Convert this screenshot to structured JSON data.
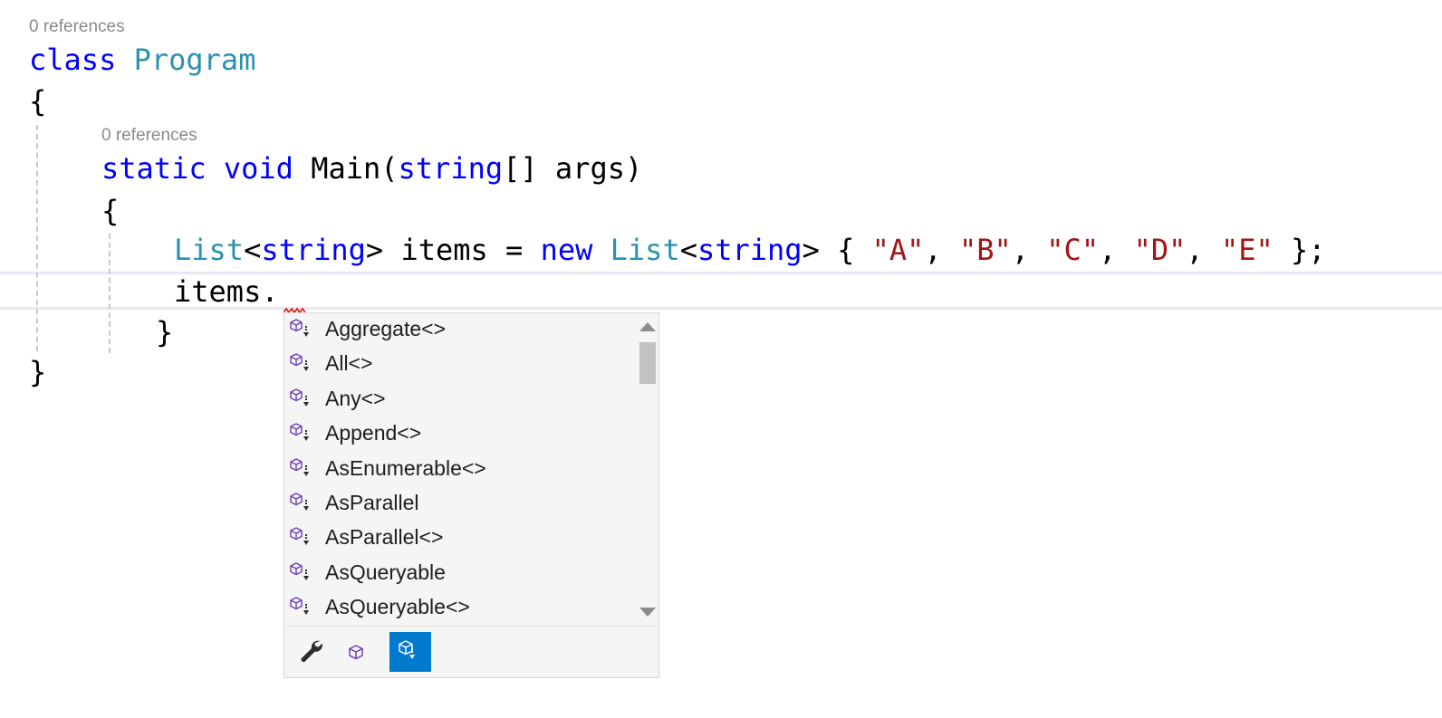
{
  "codelens": {
    "class_refs": "0 references",
    "method_refs": "0 references"
  },
  "code": {
    "line1": {
      "kw": "class",
      "type": "Program"
    },
    "line2": {
      "text": "{"
    },
    "line3": {
      "kw1": "static",
      "kw2": "void",
      "name": "Main(",
      "kw3": "string",
      "rest": "[] args)"
    },
    "line4": {
      "text": "{"
    },
    "line5": {
      "type1": "List",
      "lt1": "<",
      "kw1": "string",
      "mid1": "> items = ",
      "kw_new": "new",
      "type2": "List",
      "lt2": "<",
      "kw2": "string",
      "mid2": "> { ",
      "s1": "\"A\"",
      "c1": ", ",
      "s2": "\"B\"",
      "c2": ", ",
      "s3": "\"C\"",
      "c3": ", ",
      "s4": "\"D\"",
      "c4": ", ",
      "s5": "\"E\"",
      "end": " };"
    },
    "line6": {
      "text": "items."
    },
    "line7": {
      "text": "}"
    },
    "line8": {
      "text": "}"
    }
  },
  "completion": {
    "items": [
      {
        "label": "Aggregate<>",
        "icon": "extension-method-icon"
      },
      {
        "label": "All<>",
        "icon": "extension-method-icon"
      },
      {
        "label": "Any<>",
        "icon": "extension-method-icon"
      },
      {
        "label": "Append<>",
        "icon": "extension-method-icon"
      },
      {
        "label": "AsEnumerable<>",
        "icon": "extension-method-icon"
      },
      {
        "label": "AsParallel",
        "icon": "extension-method-icon"
      },
      {
        "label": "AsParallel<>",
        "icon": "extension-method-icon"
      },
      {
        "label": "AsQueryable",
        "icon": "extension-method-icon"
      },
      {
        "label": "AsQueryable<>",
        "icon": "extension-method-icon"
      }
    ],
    "filters": [
      {
        "icon": "wrench-icon",
        "active": false
      },
      {
        "icon": "method-icon",
        "active": false
      },
      {
        "icon": "extension-method-filter-icon",
        "active": true
      }
    ]
  },
  "colors": {
    "keyword": "#0000ff",
    "type": "#2b91af",
    "string": "#a31515",
    "codelens": "#8a8a8a",
    "active_filter": "#007acc",
    "method_icon": "#6c3fb5"
  }
}
